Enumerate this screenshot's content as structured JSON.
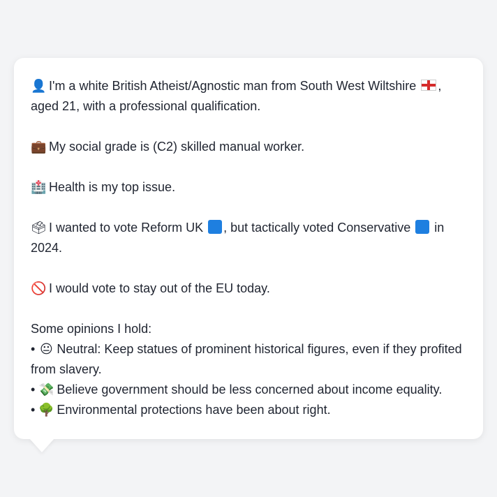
{
  "profile": {
    "intro_icon": "person-silhouette-icon",
    "intro_text": "I'm a white British Atheist/Agnostic man from South West Wiltshire",
    "intro_flag": "england-flag-icon",
    "intro_tail": ", aged 21, with a professional qualification.",
    "grade_icon": "briefcase-icon",
    "grade_text": "My social grade is (C2) skilled manual worker.",
    "health_icon": "hospital-icon",
    "health_text": "Health is my top issue.",
    "vote_icon": "ballot-box-icon",
    "vote_text_a": "I wanted to vote Reform UK",
    "vote_text_b": ", but tactically voted Conservative",
    "vote_text_c": " in 2024.",
    "party_square_color_reform": "#1e7fe0",
    "party_square_color_conservative": "#1e7fe0",
    "eu_icon": "prohibited-icon",
    "eu_text": "I would vote to stay out of the EU today.",
    "opinions_heading": "Some opinions I hold:",
    "opinions": [
      {
        "bullet": "•",
        "icon": "neutral-face-icon",
        "text": "Neutral: Keep statues of prominent historical figures, even if they profited from slavery."
      },
      {
        "bullet": "•",
        "icon": "money-wings-icon",
        "text": "Believe government should be less concerned about income equality."
      },
      {
        "bullet": "•",
        "icon": "tree-icon",
        "text": "Environmental protections have been about right."
      }
    ]
  }
}
